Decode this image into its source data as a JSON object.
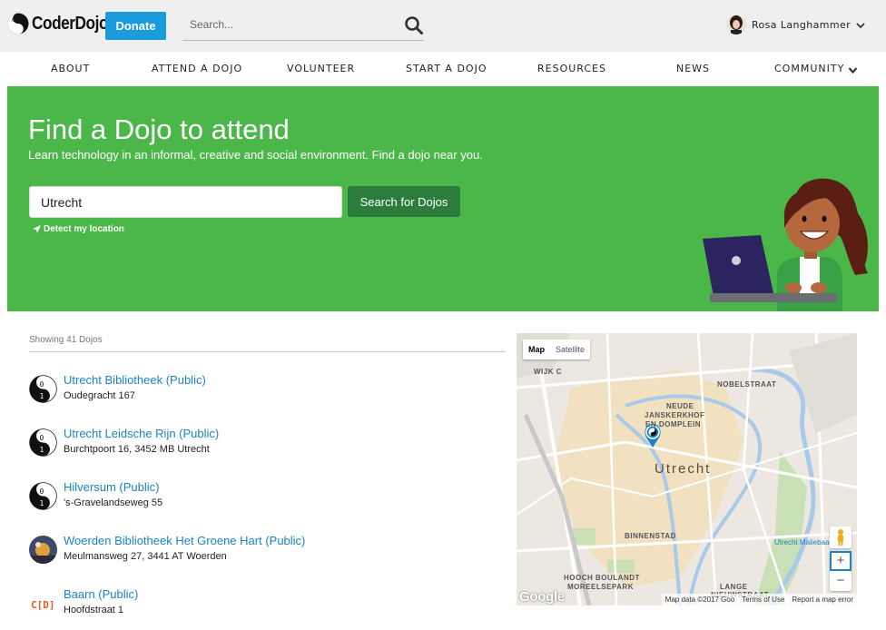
{
  "header": {
    "logo_text": "CoderDojo",
    "donate_label": "Donate",
    "search_placeholder": "Search...",
    "user_name": "Rosa Langhammer"
  },
  "nav": {
    "items": [
      "ABOUT",
      "ATTEND A DOJO",
      "VOLUNTEER",
      "START A DOJO",
      "RESOURCES",
      "NEWS",
      "COMMUNITY"
    ]
  },
  "hero": {
    "title": "Find a Dojo to attend",
    "subtitle": "Learn technology in an informal, creative and social environment. Find a dojo near you.",
    "location_value": "Utrecht",
    "search_button": "Search for Dojos",
    "detect_label": "Detect my location"
  },
  "results": {
    "count_label": "Showing 41 Dojos",
    "dojos": [
      {
        "name": "Utrecht Bibliotheek (Public)",
        "address": "Oudegracht 167",
        "logo": "coderdojo-logo"
      },
      {
        "name": "Utrecht Leidsche Rijn (Public)",
        "address": "Burchtpoort 16, 3452 MB Utrecht",
        "logo": "coderdojo-logo"
      },
      {
        "name": "Hilversum (Public)",
        "address": "'s-Gravelandseweg 55",
        "logo": "coderdojo-logo"
      },
      {
        "name": "Woerden Bibliotheek Het Groene Hart (Public)",
        "address": "Meulmansweg 27, 3441 AT Woerden",
        "logo": "photo-logo"
      },
      {
        "name": "Baarn (Public)",
        "address": "Hoofdstraat 1",
        "logo": "cdj-logo"
      }
    ]
  },
  "map": {
    "type_map": "Map",
    "type_satellite": "Satellite",
    "city": "Utrecht",
    "labels": {
      "wijk_c": "WIJK C",
      "nobelstraat": "NOBELSTRAAT",
      "neude1": "NEUDE",
      "neude2": "JANSKERKHOF",
      "neude3": "EN DOMPLEIN",
      "binnenstad": "BINNENSTAD",
      "hooch1": "HOOCH BOULANDT",
      "hooch2": "MOREELSEPARK",
      "lange1": "LANGE",
      "lange2": "NIEUWSTRAAT",
      "malieban": "Utrecht Maliebaan"
    },
    "google": "Google",
    "attribution": {
      "data": "Map data ©2017 Goo",
      "terms": "Terms of Use",
      "report": "Report a map error"
    },
    "zoom_in": "+",
    "zoom_out": "−"
  },
  "colors": {
    "hero_green": "#4ab748",
    "button_dark_green": "#2c7d3b",
    "donate_blue": "#1a9cdc",
    "link_blue": "#1a83c7"
  }
}
